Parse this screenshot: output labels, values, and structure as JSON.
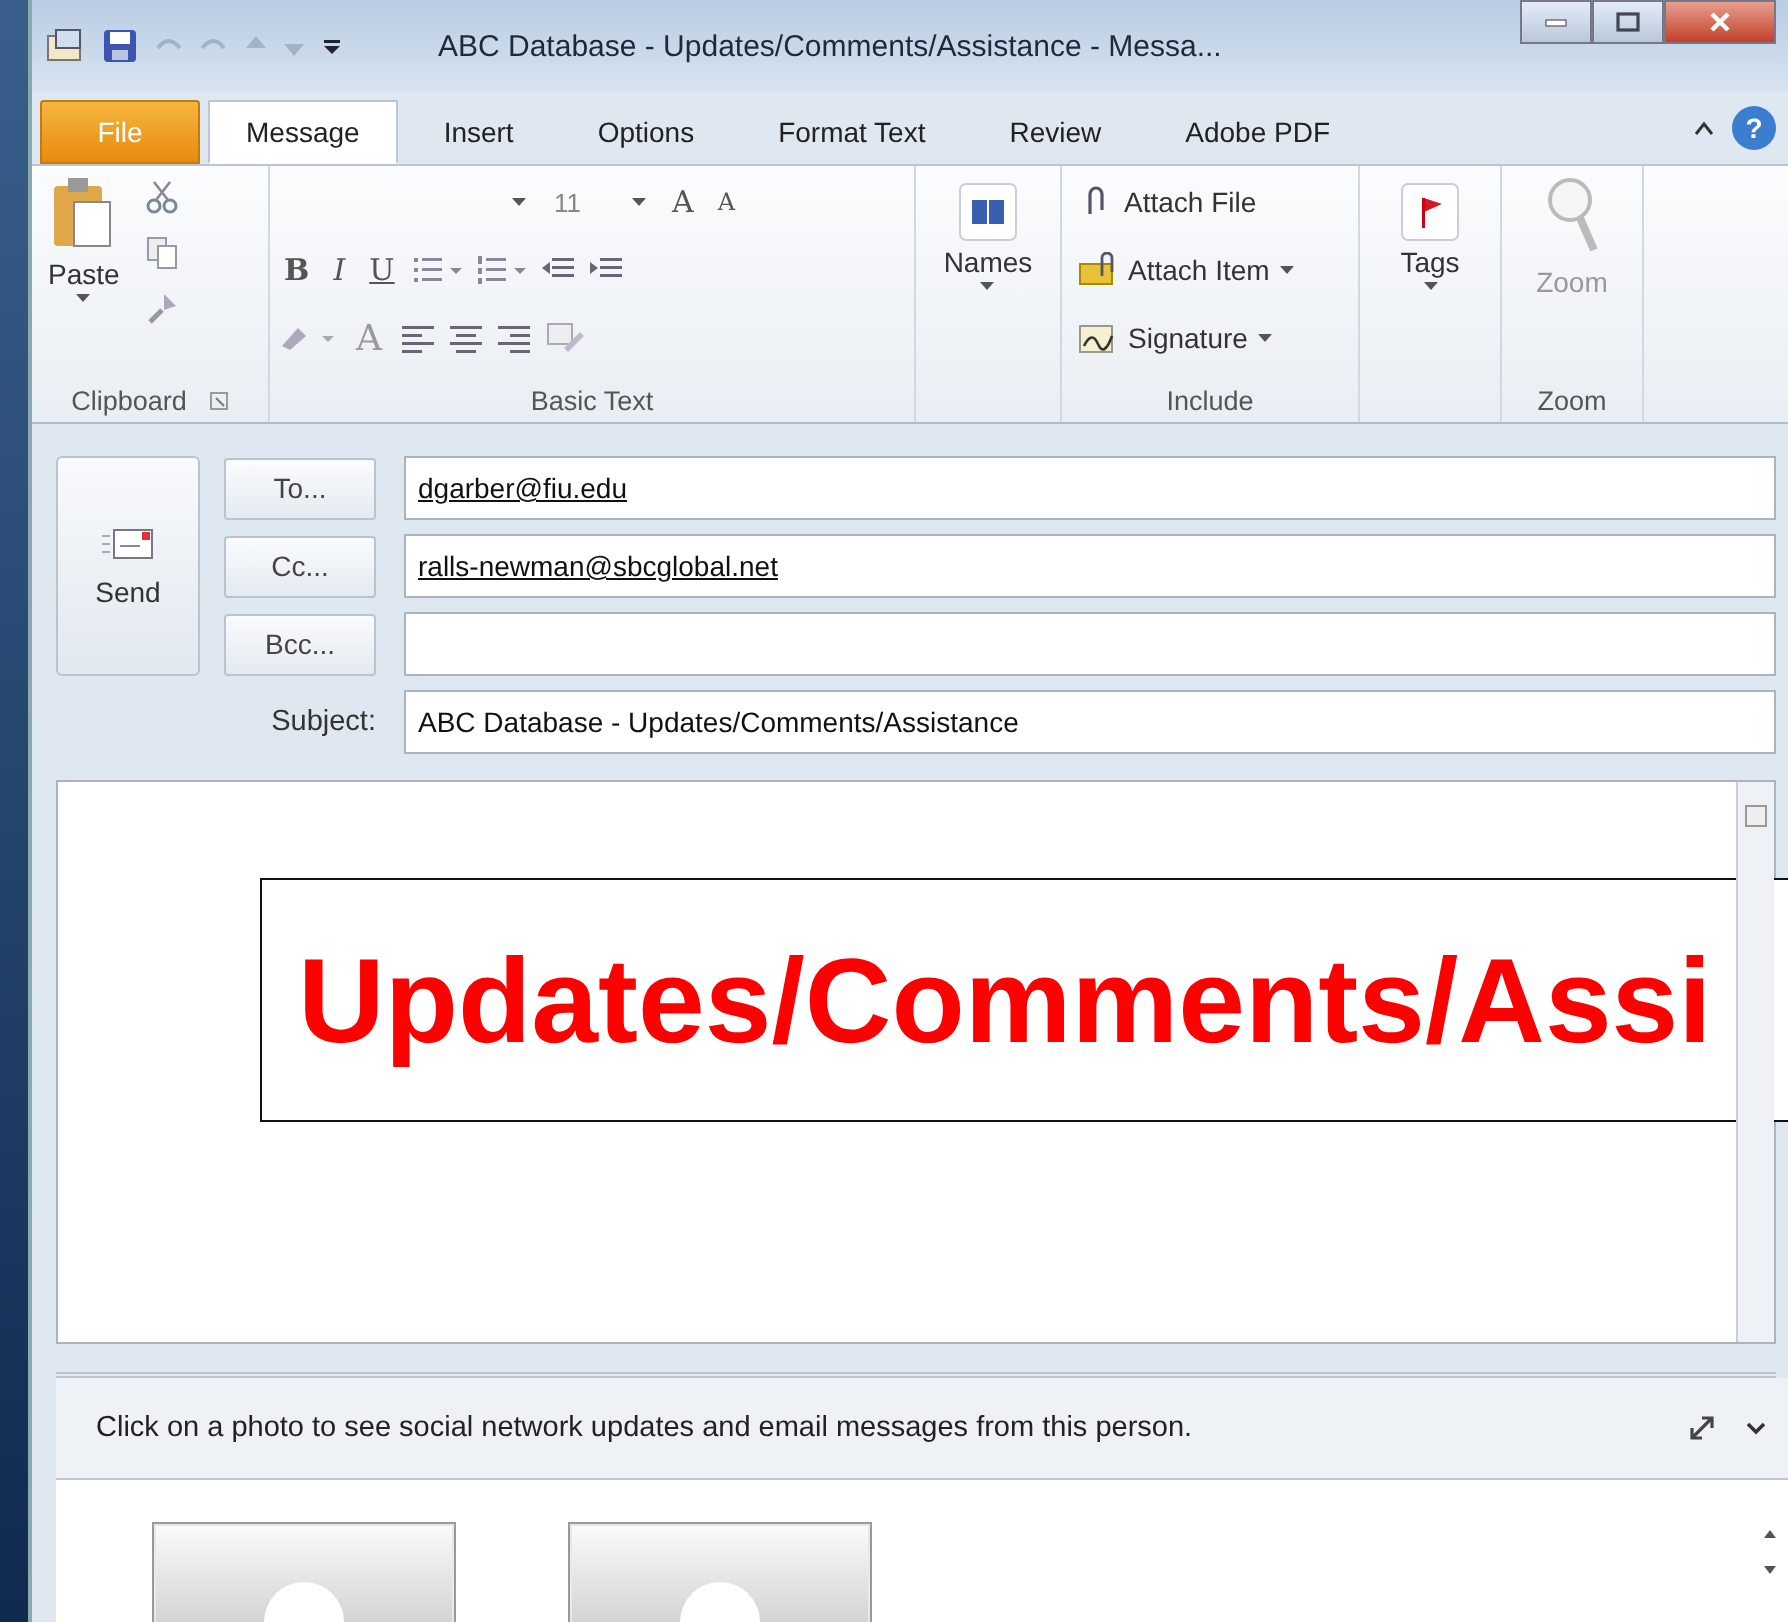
{
  "window": {
    "title": "ABC Database - Updates/Comments/Assistance -  Messa..."
  },
  "tabs": [
    {
      "label": "File",
      "kind": "file",
      "selected": false
    },
    {
      "label": "Message",
      "kind": "tab",
      "selected": true
    },
    {
      "label": "Insert",
      "kind": "tab",
      "selected": false
    },
    {
      "label": "Options",
      "kind": "tab",
      "selected": false
    },
    {
      "label": "Format Text",
      "kind": "tab",
      "selected": false
    },
    {
      "label": "Review",
      "kind": "tab",
      "selected": false
    },
    {
      "label": "Adobe PDF",
      "kind": "tab",
      "selected": false
    }
  ],
  "help": "?",
  "ribbon": {
    "clipboard": {
      "label": "Clipboard",
      "paste": "Paste"
    },
    "basic_text": {
      "label": "Basic Text",
      "font_size": "11",
      "grow": "A",
      "shrink": "A",
      "bold": "B",
      "italic": "I",
      "underline": "U",
      "font_color_label": "A"
    },
    "names": {
      "label": "Names"
    },
    "include": {
      "label": "Include",
      "items": [
        {
          "label": "Attach File",
          "dropdown": false,
          "kind": "clip"
        },
        {
          "label": "Attach Item",
          "dropdown": true,
          "kind": "item"
        },
        {
          "label": "Signature",
          "dropdown": true,
          "kind": "signature"
        }
      ]
    },
    "tags": {
      "label": "Tags"
    },
    "zoom": {
      "label": "Zoom",
      "button": "Zoom",
      "disabled": true
    }
  },
  "send": "Send",
  "recipients": [
    {
      "button": "To...",
      "value": "dgarber@fiu.edu"
    },
    {
      "button": "Cc...",
      "value": "ralls-newman@sbcglobal.net"
    },
    {
      "button": "Bcc..."
    }
  ],
  "subject": {
    "label": "Subject:",
    "value": "ABC Database - Updates/Comments/Assistance"
  },
  "overlay": "Updates/Comments/Assi",
  "people_pane": {
    "message": "Click on a photo to see social network updates and email messages from this person."
  }
}
